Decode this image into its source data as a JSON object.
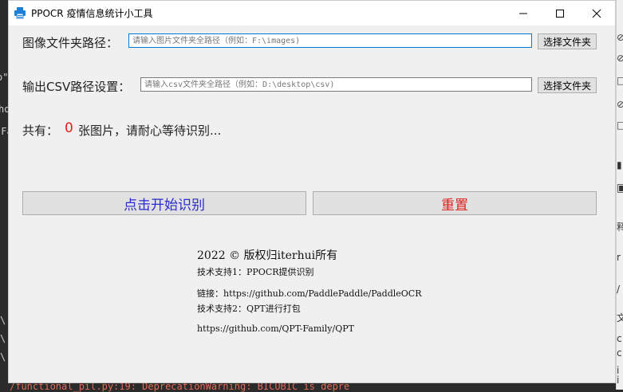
{
  "window": {
    "title": "PPOCR 疫情信息统计小工具",
    "minimize_symbol": "—",
    "maximize_symbol": "☐",
    "close_symbol": "✕"
  },
  "image_folder": {
    "label": "图像文件夹路径：",
    "placeholder": "请输入图片文件夹全路径（例如：F:\\images)",
    "button": "选择文件夹"
  },
  "csv_folder": {
    "label": "输出CSV路径设置：",
    "placeholder": "请输入csv文件夹全路径（例如：D:\\desktop\\csv)",
    "button": "选择文件夹"
  },
  "status": {
    "prefix": "共有：",
    "count": "0",
    "suffix": "张图片，请耐心等待识别..."
  },
  "actions": {
    "start_label": "点击开始识别",
    "start_color": "#2a2ad0",
    "reset_label": "重置",
    "reset_color": "#e02020"
  },
  "footer": {
    "copyright": "2022 © 版权归iterhui所有",
    "support1": "技术支持1：PPOCR提供识别",
    "link1": "链接：https://github.com/PaddlePaddle/PaddleOCR",
    "support2": "技术支持2：QPT进行打包",
    "link2": "https://github.com/QPT-Family/QPT"
  },
  "background_fragments": {
    "left": [
      "ho",
      "o\"",
      "\"Fa",
      "\\",
      "\\",
      "\\"
    ],
    "bottom": "/functional_pil.py:19: DeprecationWarning: BICUBIC is depre",
    "right": [
      "⊘",
      "⊘",
      "□",
      "⊘",
      "□",
      "▮",
      "▣",
      "释",
      "r",
      "/",
      "文",
      "c",
      "c",
      "i",
      "i"
    ]
  },
  "colors": {
    "window_bg": "#f0f0f0",
    "titlebar_bg": "#ffffff",
    "input_focus_border": "#0078d7",
    "accent_icon": "#1e7fd6"
  }
}
